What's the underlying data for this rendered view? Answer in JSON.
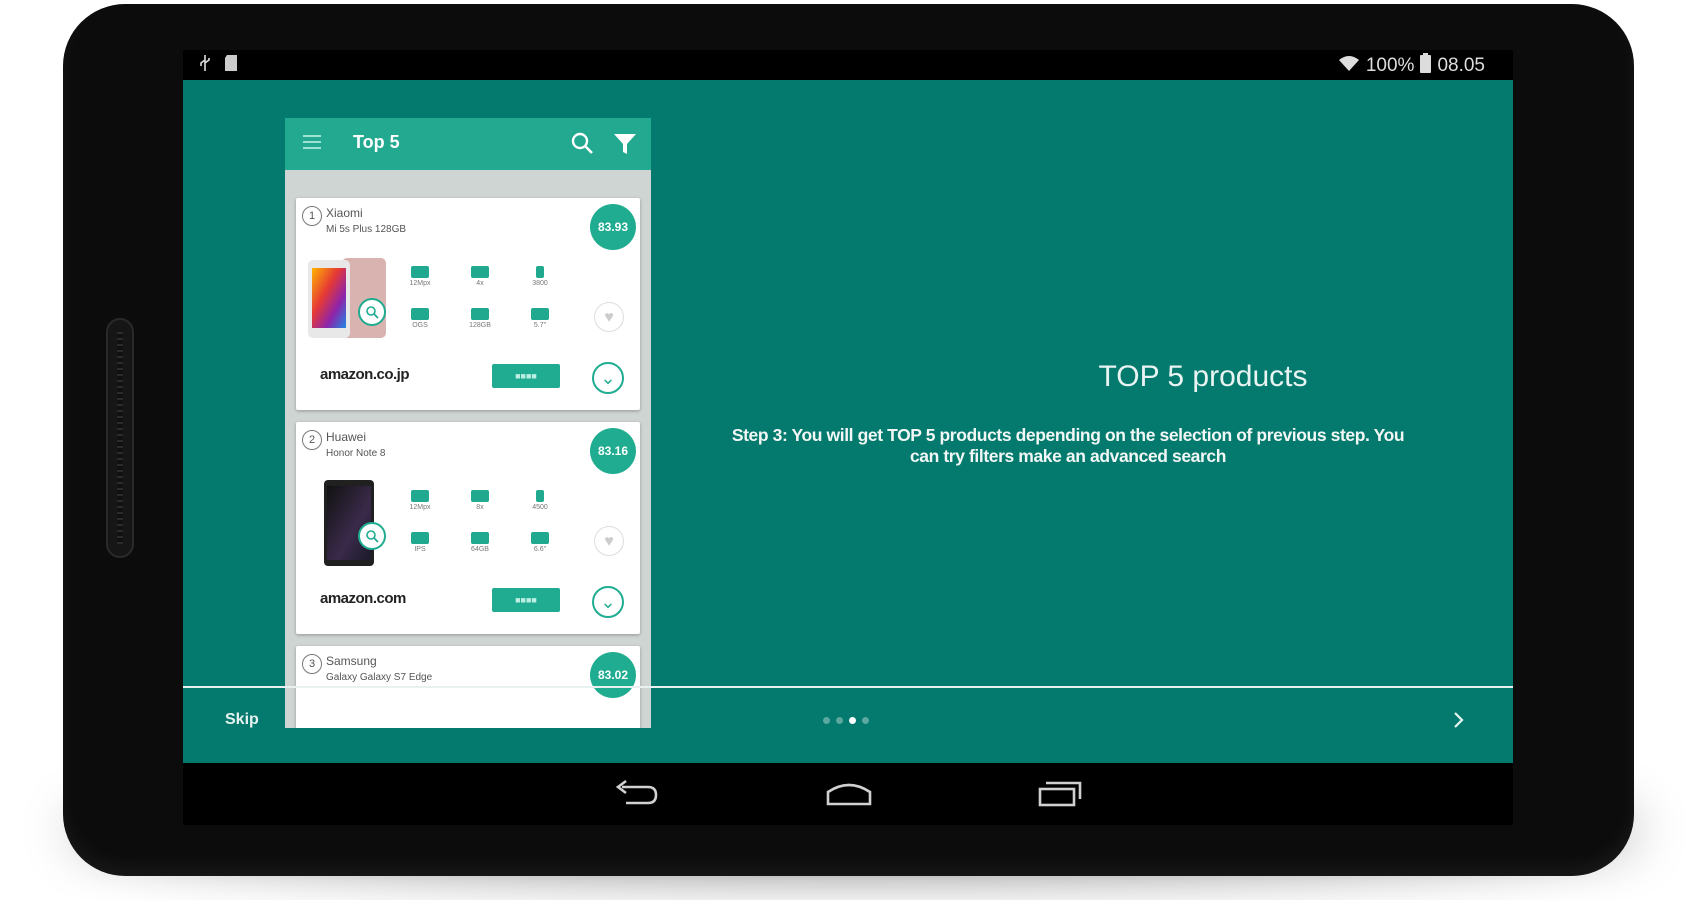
{
  "status_bar": {
    "battery_percent": "100%",
    "time": "08.05",
    "icons": [
      "usb-icon",
      "sd-card-icon",
      "wifi-icon",
      "battery-icon"
    ]
  },
  "onboarding": {
    "heading": "TOP 5 products",
    "description": "Step 3: You will get TOP 5 products depending on the selection of previous step. You can try filters make an advanced search",
    "skip_label": "Skip",
    "page_count": 4,
    "active_page": 3
  },
  "preview": {
    "title": "Top 5",
    "products": [
      {
        "rank": "1",
        "brand": "Xiaomi",
        "model": "Mi 5s Plus 128GB",
        "score": "83.93",
        "store": "amazon.co.jp",
        "specs": [
          "12Mpx",
          "4x",
          "3800",
          "OGS",
          "128GB",
          "5.7\""
        ]
      },
      {
        "rank": "2",
        "brand": "Huawei",
        "model": "Honor Note 8",
        "score": "83.16",
        "store": "amazon.com",
        "specs": [
          "12Mpx",
          "8x",
          "4500",
          "IPS",
          "64GB",
          "6.6\""
        ]
      },
      {
        "rank": "3",
        "brand": "Samsung",
        "model": "Galaxy Galaxy S7 Edge",
        "score": "83.02"
      }
    ]
  },
  "colors": {
    "background": "#037a6d",
    "accent": "#20ac90",
    "preview_bar": "#23a98f"
  }
}
